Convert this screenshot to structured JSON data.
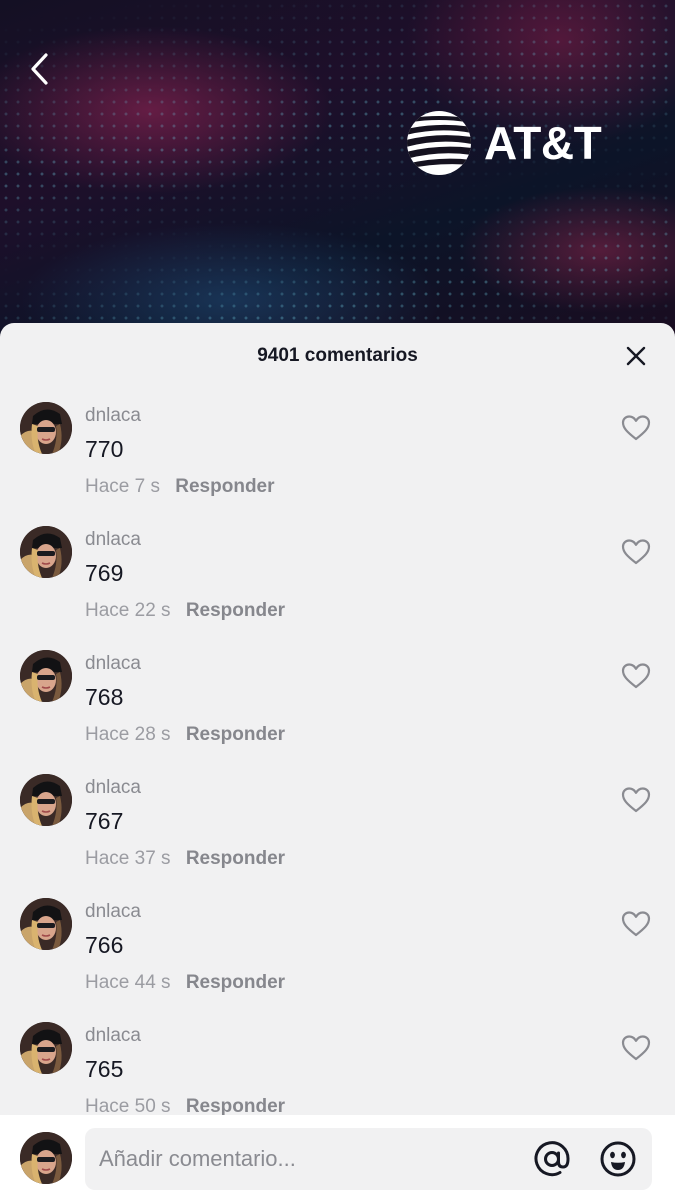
{
  "video": {
    "brand_name": "AT&T"
  },
  "sheet": {
    "title": "9401 comentarios"
  },
  "comments": [
    {
      "user": "dnlaca",
      "text": "770",
      "time": "Hace 7 s",
      "reply": "Responder"
    },
    {
      "user": "dnlaca",
      "text": "769",
      "time": "Hace 22 s",
      "reply": "Responder"
    },
    {
      "user": "dnlaca",
      "text": "768",
      "time": "Hace 28 s",
      "reply": "Responder"
    },
    {
      "user": "dnlaca",
      "text": "767",
      "time": "Hace 37 s",
      "reply": "Responder"
    },
    {
      "user": "dnlaca",
      "text": "766",
      "time": "Hace 44 s",
      "reply": "Responder"
    },
    {
      "user": "dnlaca",
      "text": "765",
      "time": "Hace 50 s",
      "reply": "Responder"
    }
  ],
  "composer": {
    "placeholder": "Añadir comentario..."
  },
  "icons": {
    "back": "chevron-left-icon",
    "close": "close-icon",
    "like": "heart-outline-icon",
    "mention": "at-sign-icon",
    "emoji": "emoji-icon",
    "brand": "att-globe-logo"
  },
  "colors": {
    "sheet_bg": "#f1f1f2",
    "text_primary": "#161823",
    "text_secondary": "#8a8b91"
  }
}
